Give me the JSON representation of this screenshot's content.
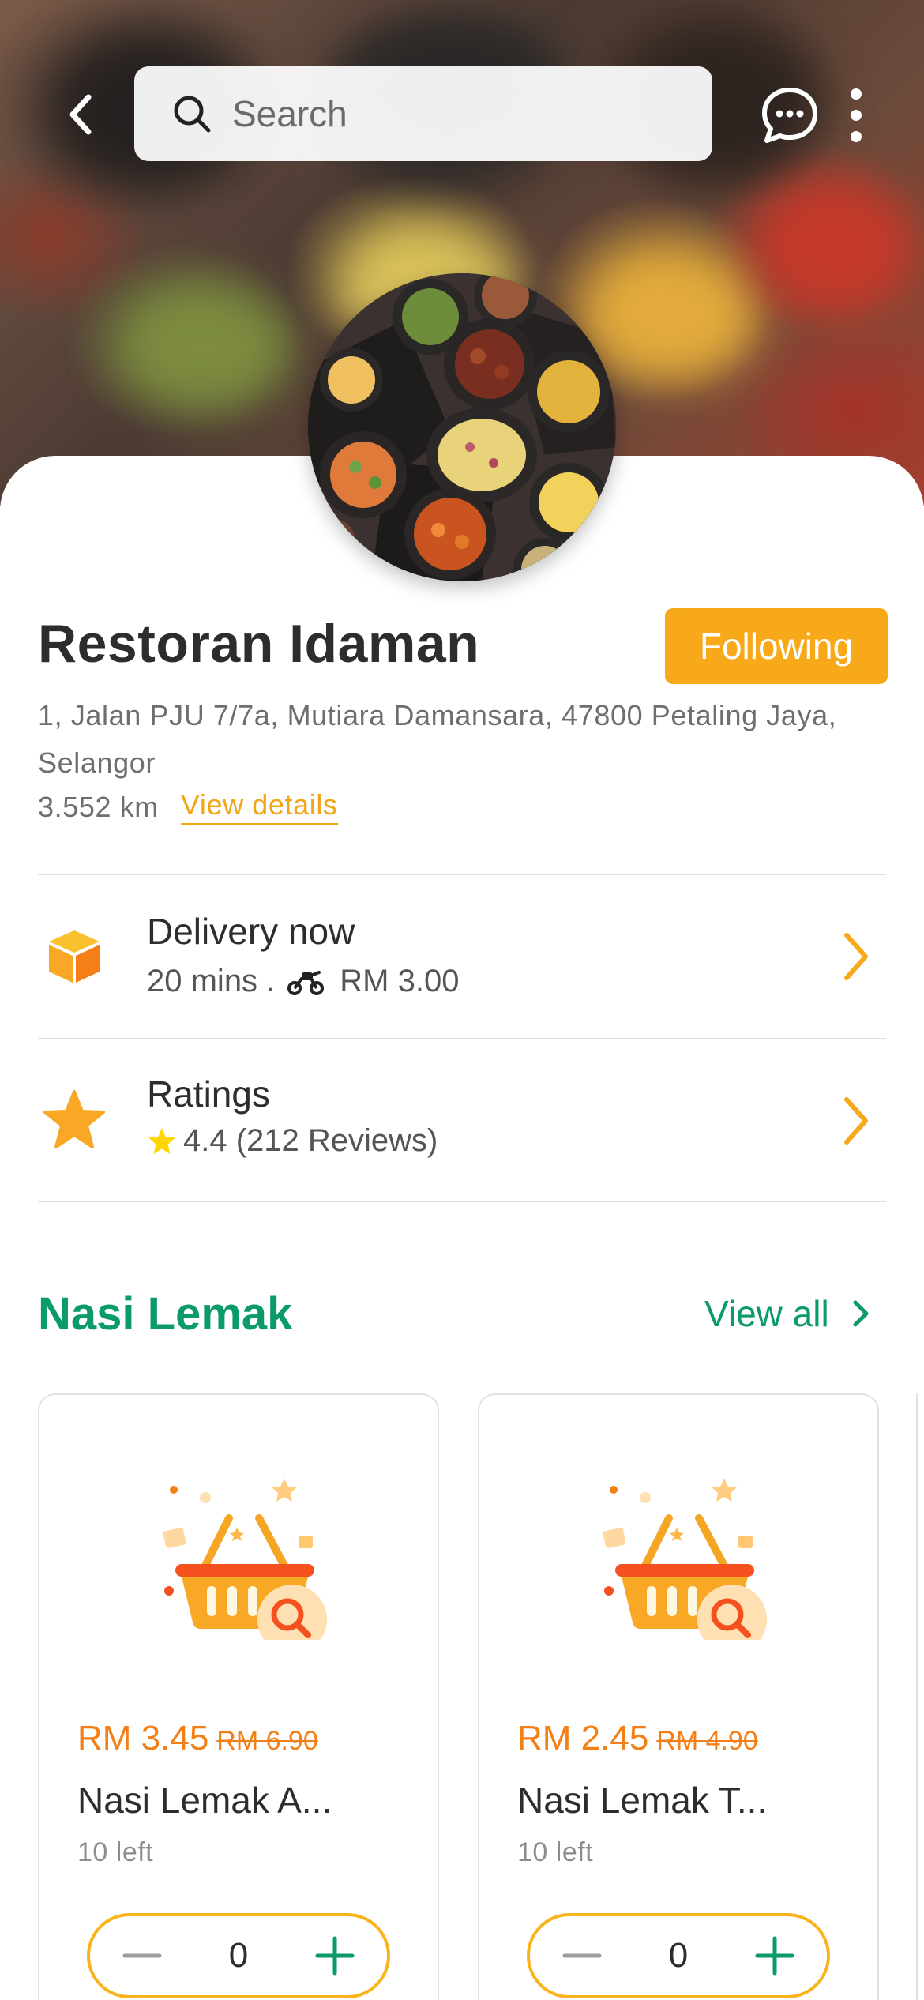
{
  "header": {
    "search_placeholder": "Search"
  },
  "store": {
    "name": "Restoran Idaman",
    "follow_label": "Following",
    "address": "1, Jalan PJU 7/7a, Mutiara Damansara, 47800 Petaling Jaya, Selangor",
    "distance": "3.552 km",
    "view_details_label": "View details"
  },
  "delivery": {
    "title": "Delivery now",
    "time": "20 mins .",
    "fee": "RM 3.00"
  },
  "ratings": {
    "title": "Ratings",
    "score_text": "4.4 (212 Reviews)"
  },
  "section": {
    "title": "Nasi Lemak",
    "view_all_label": "View all"
  },
  "products": [
    {
      "price": "RM 3.45",
      "old_price": "RM 6.90",
      "name": "Nasi Lemak A...",
      "stock": "10 left",
      "qty": "0"
    },
    {
      "price": "RM 2.45",
      "old_price": "RM 4.90",
      "name": "Nasi Lemak T...",
      "stock": "10 left",
      "qty": "0"
    }
  ],
  "colors": {
    "accent_orange": "#f8a91a",
    "price_orange": "#f57f17",
    "brand_green": "#0b9a6a",
    "plus_green": "#0b9a6a"
  },
  "icons": {
    "back": "chevron-left-icon",
    "search": "search-icon",
    "chat": "chat-bubble-icon",
    "more": "more-vertical-icon",
    "delivery": "box-icon",
    "ratings": "star-icon",
    "row_chevron": "chevron-right-icon",
    "motorbike": "motorbike-icon",
    "product_placeholder": "basket-icon"
  }
}
